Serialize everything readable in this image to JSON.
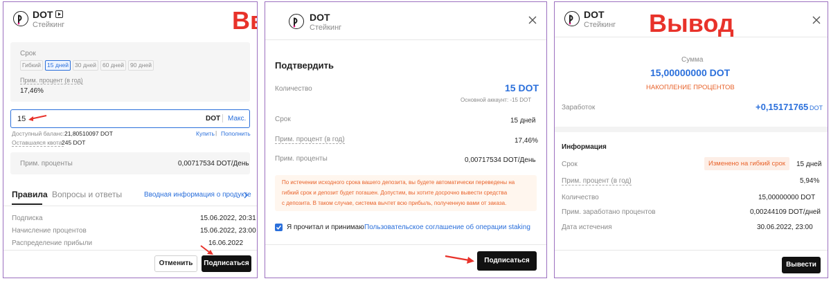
{
  "colors": {
    "accent_blue": "#2a6fdb",
    "label_red": "#e8322a",
    "orange": "#e8622a",
    "frame": "#9b6fbf",
    "button_dark": "#111111"
  },
  "panel_enter": {
    "coin": "DOT",
    "subtitle": "Стейкинг",
    "overlay_label": "Ввод",
    "term_label": "Срок",
    "term_options": [
      "Гибкий",
      "15 дней",
      "30 дней",
      "60 дней",
      "90 дней"
    ],
    "term_selected": "15 дней",
    "apr_label": "Прим. процент (в год)",
    "apr_value": "17,46%",
    "amount_value": "15",
    "amount_unit": "DOT",
    "max_label": "Макс.",
    "available_label": "Доступный баланс:",
    "available_value": "21,80510097 DOT",
    "buy_link": "Купить",
    "deposit_link": "Пополнить",
    "quota_label": "Оставшаяся квота:",
    "quota_value": "245 DOT",
    "est_interest_label": "Прим. проценты",
    "est_interest_value": "0,00717534 DOT/День",
    "tab_rules": "Правила",
    "tab_faq": "Вопросы и ответы",
    "product_intro_link": "Вводная информация о продукте",
    "rows": [
      {
        "label": "Подписка",
        "value": "15.06.2022, 20:31"
      },
      {
        "label": "Начисление процентов",
        "value": "15.06.2022, 23:00"
      },
      {
        "label": "Распределение прибыли",
        "value": "16.06.2022"
      }
    ],
    "cancel_button": "Отменить",
    "subscribe_button": "Подписаться"
  },
  "panel_confirm": {
    "coin": "DOT",
    "subtitle": "Стейкинг",
    "heading": "Подтвердить",
    "qty_label": "Количество",
    "qty_value": "15 DOT",
    "main_account_note": "Основной аккаунт: -15 DOT",
    "term_label": "Срок",
    "term_value": "15 дней",
    "apr_label": "Прим. процент (в год)",
    "apr_value": "17,46%",
    "interest_label": "Прим. проценты",
    "interest_value": "0,00717534 DOT/День",
    "notice_lines": [
      "По истечении исходного срока вашего депозита, вы будете автоматически переведены на",
      "гибкий срок и депозит будет погашен. Допустим, вы хотите досрочно вывести средства",
      "с депозита. В таком случае, система вычтет всю прибыль, полученную вами от заказа."
    ],
    "agree_text": "Я прочитал и принимаю",
    "agree_link": "Пользовательское соглашение об операции staking",
    "subscribe_button": "Подписаться"
  },
  "panel_withdraw": {
    "coin": "DOT",
    "subtitle": "Стейкинг",
    "overlay_label": "Вывод",
    "sum_label": "Сумма",
    "sum_value": "15,00000000 DOT",
    "status": "НАКОПЛЕНИЕ ПРОЦЕНТОВ",
    "earnings_label": "Заработок",
    "earnings_value": "+0,15171765",
    "earnings_unit": "DOT",
    "info_heading": "Информация",
    "term_label": "Срок",
    "term_badge": "Изменено на гибкий срок",
    "term_value": "15 дней",
    "apr_label": "Прим. процент (в год)",
    "apr_value": "5,94%",
    "qty_label": "Количество",
    "qty_value": "15,00000000 DOT",
    "earned_label": "Прим. заработано процентов",
    "earned_value": "0,00244109 DOT/дней",
    "expiry_label": "Дата истечения",
    "expiry_value": "30.06.2022, 23:00",
    "withdraw_button": "Вывести"
  }
}
